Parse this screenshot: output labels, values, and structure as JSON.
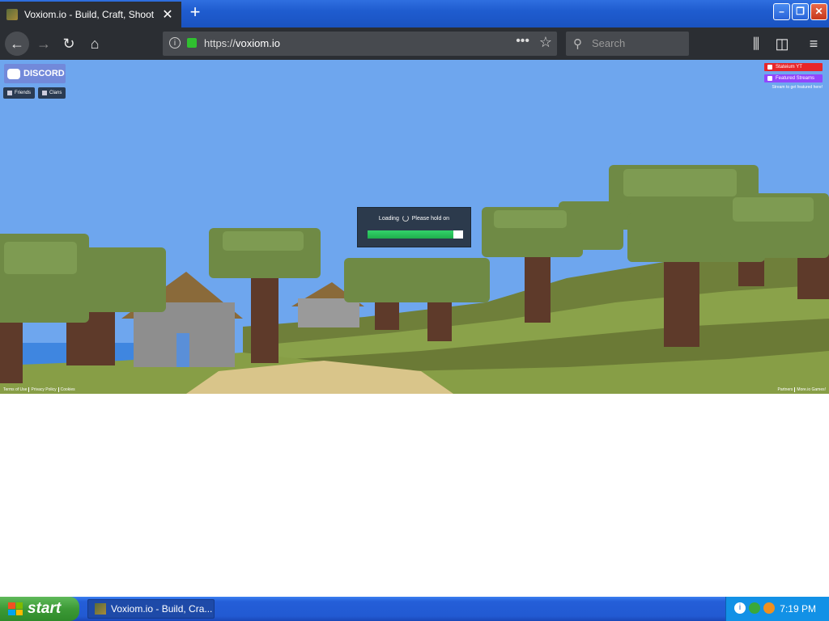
{
  "browser": {
    "tab_title": "Voxiom.io - Build, Craft, Shoot",
    "tab_close": "✕",
    "new_tab": "+",
    "url_prefix": "https://",
    "url_domain": "voxiom.io",
    "search_placeholder": "Search",
    "icons": [
      "back-icon",
      "forward-icon",
      "reload-icon",
      "home-icon",
      "info-icon",
      "lock-icon",
      "page-actions-icon",
      "bookmark-star-icon",
      "search-icon",
      "library-icon",
      "sidebar-icon",
      "menu-icon"
    ]
  },
  "game": {
    "discord_label": "DISCORD",
    "friends_label": "Friends",
    "clans_label": "Clans",
    "streamer_yt": "Stateium YT",
    "featured_streams": "Featured Streams",
    "streamer_note": "Stream to get featured here!",
    "loading_text": "Loading",
    "hold_text": "Please hold on",
    "loading_progress": 0.9,
    "footer_left": [
      "Terms of Use",
      "Privacy Policy",
      "Cookies"
    ],
    "footer_right": [
      "Partners",
      "More.io Games!"
    ]
  },
  "taskbar": {
    "start_label": "start",
    "task_label": "Voxiom.io - Build, Cra...",
    "clock": "7:19 PM"
  },
  "colors": {
    "sky": "#6ea6ee",
    "grass": "#7f9a3e",
    "discord": "#7289da",
    "progress": "#26c25a"
  }
}
